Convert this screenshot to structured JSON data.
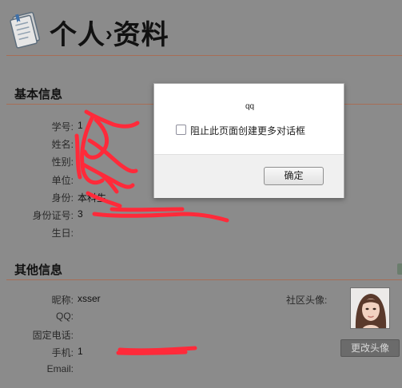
{
  "page": {
    "title_part1": "个人",
    "title_sep": "›",
    "title_part2": "资料"
  },
  "basic": {
    "section_title": "基本信息",
    "fields": [
      {
        "label": "学号:",
        "value": "1"
      },
      {
        "label": "姓名:",
        "value": ""
      },
      {
        "label": "性别:",
        "value": ""
      },
      {
        "label": "单位:",
        "value": ""
      },
      {
        "label": "身份:",
        "value": "本科生"
      },
      {
        "label": "身份证号:",
        "value": "3"
      },
      {
        "label": "生日:",
        "value": ""
      }
    ]
  },
  "other": {
    "section_title": "其他信息",
    "fields": [
      {
        "label": "昵称:",
        "value": "xsser"
      },
      {
        "label": "QQ:",
        "value": ""
      },
      {
        "label": "固定电话:",
        "value": ""
      },
      {
        "label": "手机:",
        "value": "1"
      },
      {
        "label": "Email:",
        "value": ""
      }
    ],
    "avatar_label": "社区头像:",
    "change_avatar_label": "更改头像"
  },
  "dialog": {
    "message": "qq",
    "checkbox_label": "阻止此页面创建更多对话框",
    "checked": false,
    "ok_label": "确定"
  },
  "colors": {
    "overlay_background": "#8b8b8b",
    "divider": "#a86d55",
    "redaction": "#ff2a3a",
    "dialog_footer": "#f0f0f0"
  },
  "icons": [
    "notebook-icon",
    "avatar-photo"
  ]
}
